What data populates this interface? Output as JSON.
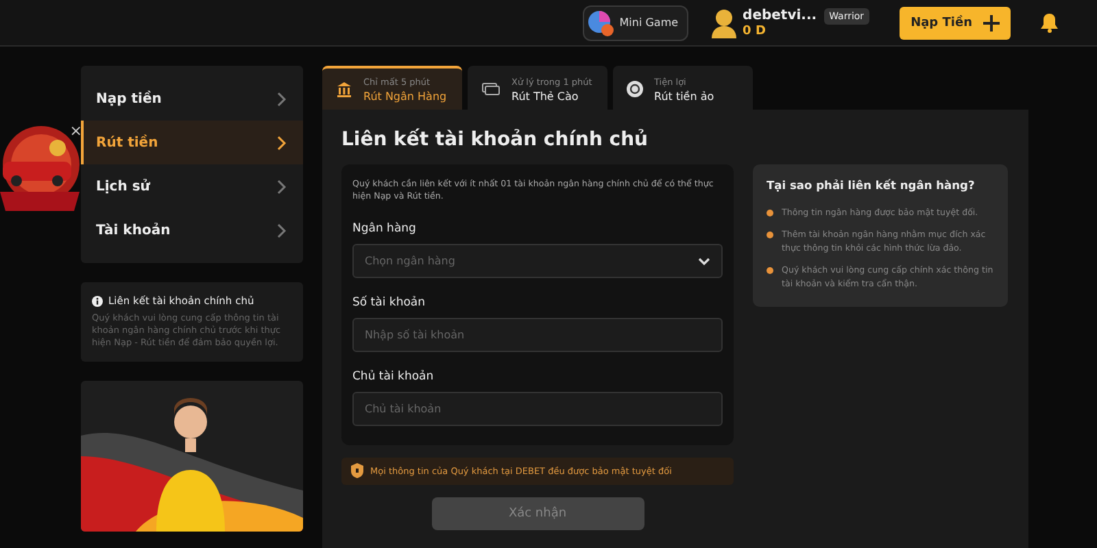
{
  "header": {
    "mini_game": "Mini Game",
    "username": "debetvi...",
    "rank": "Warrior",
    "balance": "0 D",
    "deposit_button": "Nạp Tiền"
  },
  "promo": {
    "close": "×"
  },
  "sidebar": {
    "items": [
      {
        "label": "Nạp tiền",
        "selected": false
      },
      {
        "label": "Rút tiền",
        "selected": true
      },
      {
        "label": "Lịch sử",
        "selected": false
      },
      {
        "label": "Tài khoản",
        "selected": false
      }
    ],
    "info": {
      "title": "Liên kết tài khoản chính chủ",
      "text": "Quý khách vui lòng cung cấp thông tin tài khoản ngân hàng chính chủ trước khi thực hiện Nạp - Rút tiền để đảm bảo quyền lợi."
    }
  },
  "tabs": [
    {
      "kind": "bank",
      "hint": "Chỉ mất 5 phút",
      "label": "Rút Ngân Hàng",
      "selected": true
    },
    {
      "kind": "card",
      "hint": "Xử lý trong 1 phút",
      "label": "Rút Thẻ Cào",
      "selected": false
    },
    {
      "kind": "coin",
      "hint": "Tiện lợi",
      "label": "Rút tiền ảo",
      "selected": false
    }
  ],
  "heading": "Liên kết tài khoản chính chủ",
  "form": {
    "intro": "Quý khách cần liên kết với ít nhất 01 tài khoản ngân hàng chính chủ để có thể thực hiện Nạp và Rút tiền.",
    "fields": [
      {
        "kind": "select",
        "label": "Ngân hàng",
        "placeholder": "Chọn ngân hàng"
      },
      {
        "kind": "text",
        "label": "Số tài khoản",
        "placeholder": "Nhập số tài khoản"
      },
      {
        "kind": "text",
        "label": "Chủ tài khoản",
        "placeholder": "Chủ tài khoản"
      }
    ]
  },
  "security_note": "Mọi thông tin của Quý khách tại DEBET đều được bảo mật tuyệt đối",
  "submit": {
    "label": "Xác nhận",
    "disabled": true
  },
  "why": {
    "title": "Tại sao phải liên kết ngân hàng?",
    "points": [
      "Thông tin ngân hàng được bảo mật tuyệt đối.",
      "Thêm tài khoản ngân hàng nhằm mục đích xác thực thông tin khỏi các hình thức lừa đảo.",
      "Quý khách vui lòng cung cấp chính xác thông tin tài khoản và kiểm tra cẩn thận."
    ]
  }
}
